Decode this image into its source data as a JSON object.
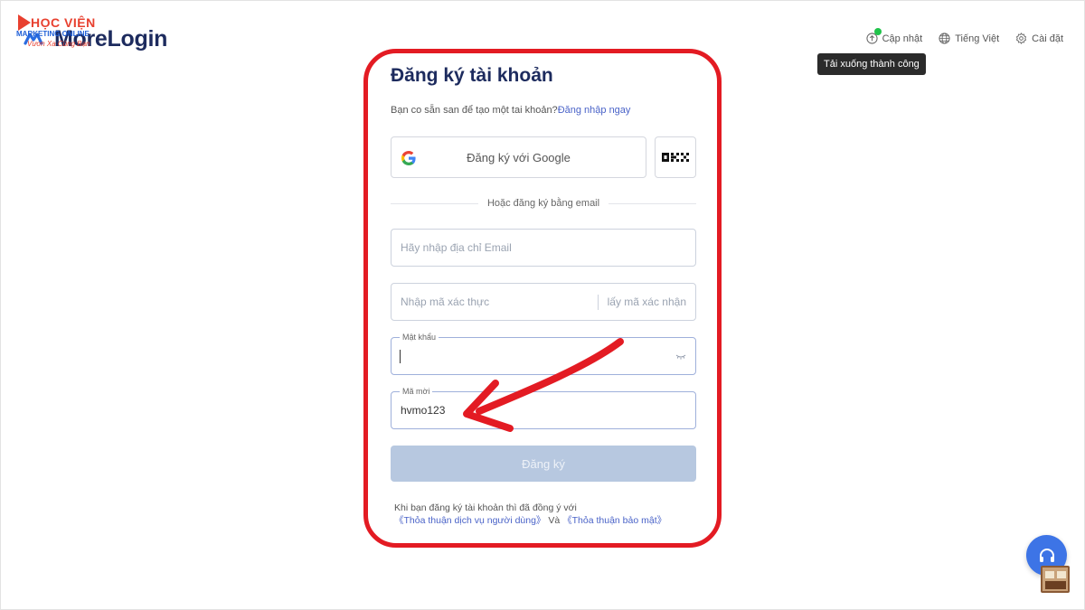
{
  "logo": {
    "hv_name": "HỌC VIỆN",
    "hv_sub": "MARKETING ONLINE",
    "hv_tag": "Vươn Xa Cùng Bạn",
    "app_name": "MoreLogin"
  },
  "topnav": {
    "update": "Cập nhật",
    "language": "Tiếng Việt",
    "settings": "Cài đặt",
    "tooltip": "Tải xuống thành công"
  },
  "form": {
    "title": "Đăng ký tài khoản",
    "login_prompt": "Bạn co sẵn san để tạo một tai khoản?",
    "login_link": "Đăng nhập ngay",
    "google_btn": "Đăng ký với Google",
    "divider": "Hoặc đăng ký bằng email",
    "email_placeholder": "Hãy nhập địa chỉ Email",
    "code_placeholder": "Nhập mã xác thực",
    "code_link": "lấy mã xác nhận",
    "password_label": "Mật khẩu",
    "password_value": "",
    "invite_label": "Mã mời",
    "invite_value": "hvmo123",
    "submit": "Đăng ký",
    "terms_text": "Khi bạn đăng ký tài khoản thì đã đồng ý với",
    "terms_link1": "《Thỏa thuận dịch vụ người dùng》",
    "terms_and": "Và",
    "terms_link2": "《Thỏa thuận bảo mật》"
  },
  "colors": {
    "highlight": "#e31b23",
    "primary_text": "#1d2b5e",
    "link": "#4a63c8",
    "submit_disabled": "#b7c8e0",
    "support": "#3d74e6",
    "update_dot": "#1fc34a"
  }
}
